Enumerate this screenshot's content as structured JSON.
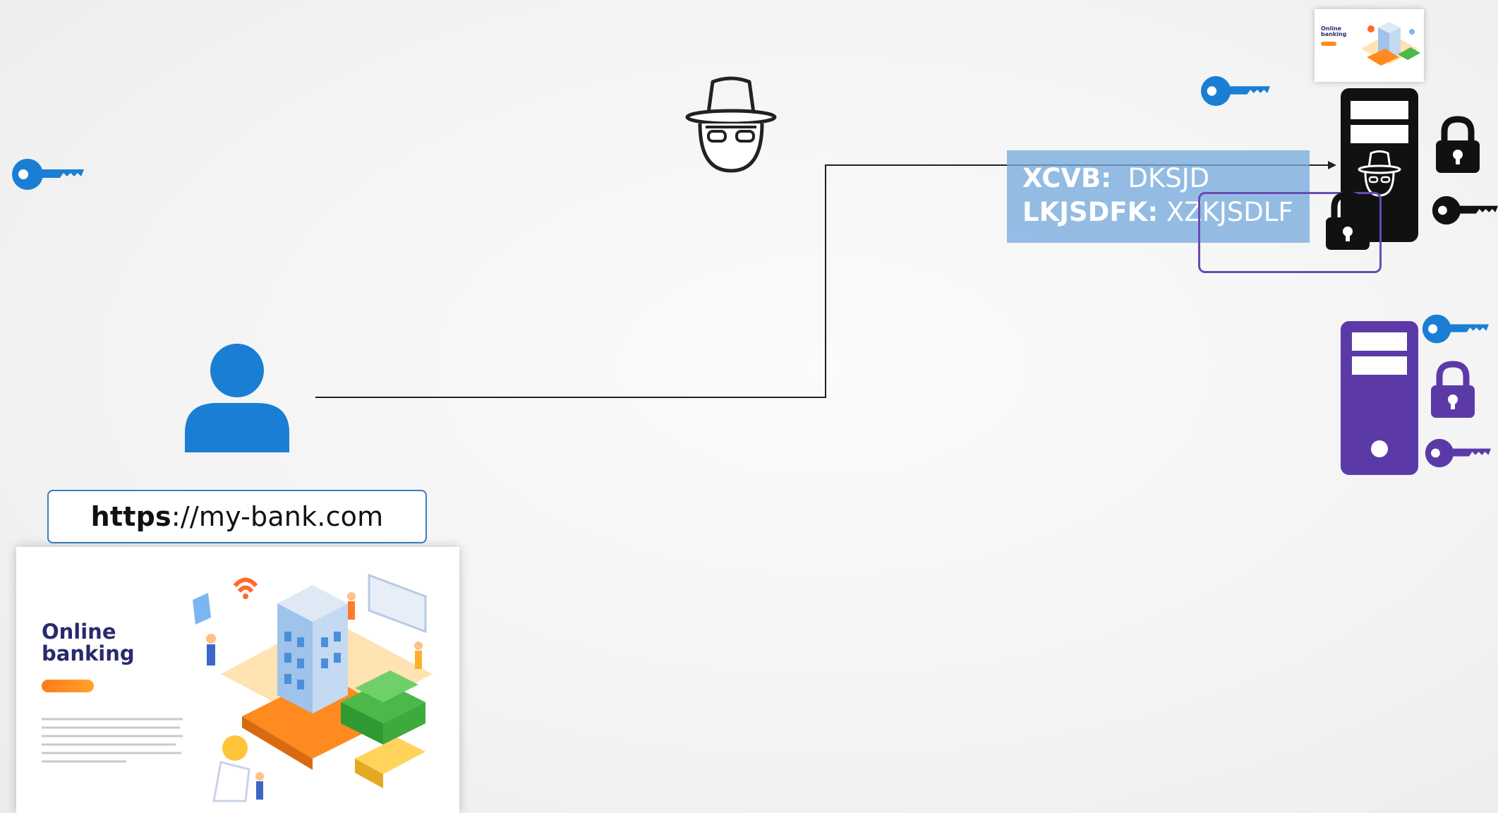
{
  "url_bar": {
    "protocol": "https",
    "rest": "://my-bank.com"
  },
  "bank_page": {
    "title": "Online\nbanking"
  },
  "thumbnail": {
    "title": "Online\nbanking"
  },
  "intercepted_data": {
    "rows": [
      {
        "key": "XCVB:",
        "value": "DKSJD"
      },
      {
        "key": "LKJSDFK:",
        "value": "XZKJSDLF"
      }
    ]
  },
  "colors": {
    "user_blue": "#1a7fd4",
    "key_blue": "#1a7fd4",
    "server_black": "#111111",
    "server_purple": "#5b3aa8",
    "cipher_box": "#78acde",
    "frame_purple": "#6a4ab5"
  },
  "icons": {
    "user": "user-icon",
    "hacker": "hacker-icon",
    "key": "key-icon",
    "lock": "padlock-icon",
    "server": "server-icon"
  }
}
